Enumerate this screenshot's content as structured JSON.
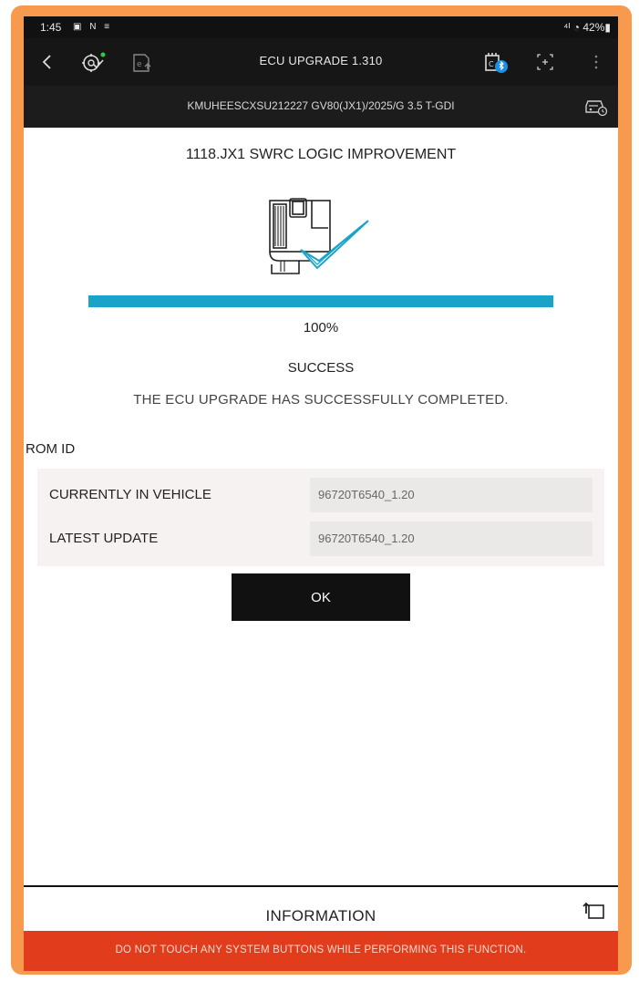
{
  "status_bar": {
    "time": "1:45",
    "notification_icons": "▣ N ≡",
    "right": "⁴ᴵ ◔ 42%▮"
  },
  "app_bar": {
    "title": "ECU UPGRADE 1.310",
    "icons": [
      "back-arrow-icon",
      "ecu-check-icon",
      "upgrade-icon",
      "bluetooth-vci-icon",
      "screenshot-icon",
      "more-menu-icon"
    ]
  },
  "vehicle": {
    "info": "KMUHEESCXSU212227  GV80(JX1)/2025/G 3.5 T-GDI"
  },
  "upgrade": {
    "title": "1118.JX1 SWRC LOGIC IMPROVEMENT",
    "progress": 1.0,
    "percent_text": "100%",
    "status": "SUCCESS",
    "message": "THE ECU UPGRADE HAS SUCCESSFULLY COMPLETED."
  },
  "rom": {
    "label": "ROM ID",
    "rows": [
      {
        "label": "CURRENTLY IN VEHICLE",
        "value": "96720T6540_1.20"
      },
      {
        "label": "LATEST UPDATE",
        "value": "96720T6540_1.20"
      }
    ]
  },
  "ok_label": "OK",
  "footer": {
    "info_label": "INFORMATION",
    "warning": "DO NOT TOUCH ANY SYSTEM BUTTONS WHILE PERFORMING THIS FUNCTION."
  },
  "colors": {
    "accent": "#1aa3c8",
    "frame": "#f79a4e",
    "warning_bar": "#e13c1b",
    "header": "#161616"
  }
}
